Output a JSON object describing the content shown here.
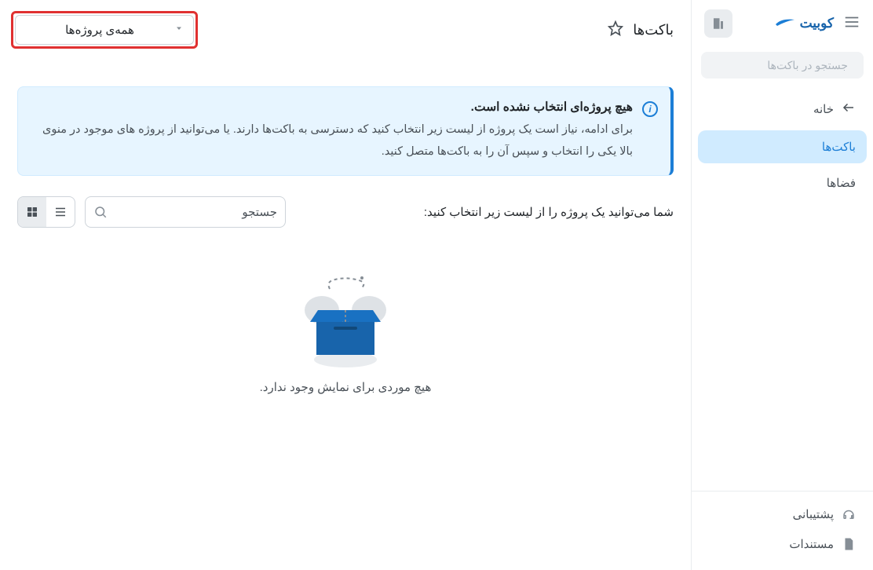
{
  "brand": {
    "name": "کوبیت"
  },
  "sidebar": {
    "search_placeholder": "جستجو در باکت‌ها",
    "nav": [
      {
        "label": "خانه",
        "key": "home"
      },
      {
        "label": "باکت‌ها",
        "key": "buckets",
        "active": true
      },
      {
        "label": "فضاها",
        "key": "spaces"
      }
    ],
    "footer": [
      {
        "label": "پشتیبانی",
        "key": "support"
      },
      {
        "label": "مستندات",
        "key": "docs"
      }
    ]
  },
  "topbar": {
    "title": "باکت‌ها",
    "project_select": "همه‌ی پروژه‌ها"
  },
  "alert": {
    "title": "هیچ پروژه‌ای انتخاب نشده است.",
    "text": "برای ادامه، نیاز است یک پروژه از لیست زیر انتخاب کنید که دسترسی به باکت‌ها دارند. یا می‌توانید از پروژه های موجود در منوی بالا یکی را انتخاب و سپس آن را به باکت‌ها متصل کنید."
  },
  "toolbar": {
    "prompt": "شما می‌توانید یک پروژه را از لیست زیر انتخاب کنید:",
    "search_placeholder": "جستجو"
  },
  "empty": {
    "text": "هیچ موردی برای نمایش وجود ندارد."
  }
}
